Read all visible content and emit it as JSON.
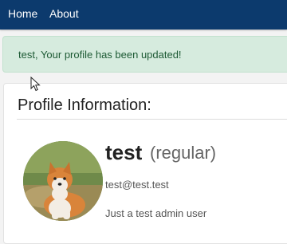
{
  "nav": {
    "home_label": "Home",
    "about_label": "About"
  },
  "alert": {
    "message": "test, Your profile has been updated!"
  },
  "profile": {
    "heading": "Profile Information:",
    "username": "test",
    "role": "(regular)",
    "email": "test@test.test",
    "bio": "Just a test admin user",
    "avatar_icon": "avatar-dog-photo"
  },
  "colors": {
    "navbar": "#0c3a6d",
    "alert_background": "#d6ebde",
    "alert_text": "#1d5a34"
  }
}
